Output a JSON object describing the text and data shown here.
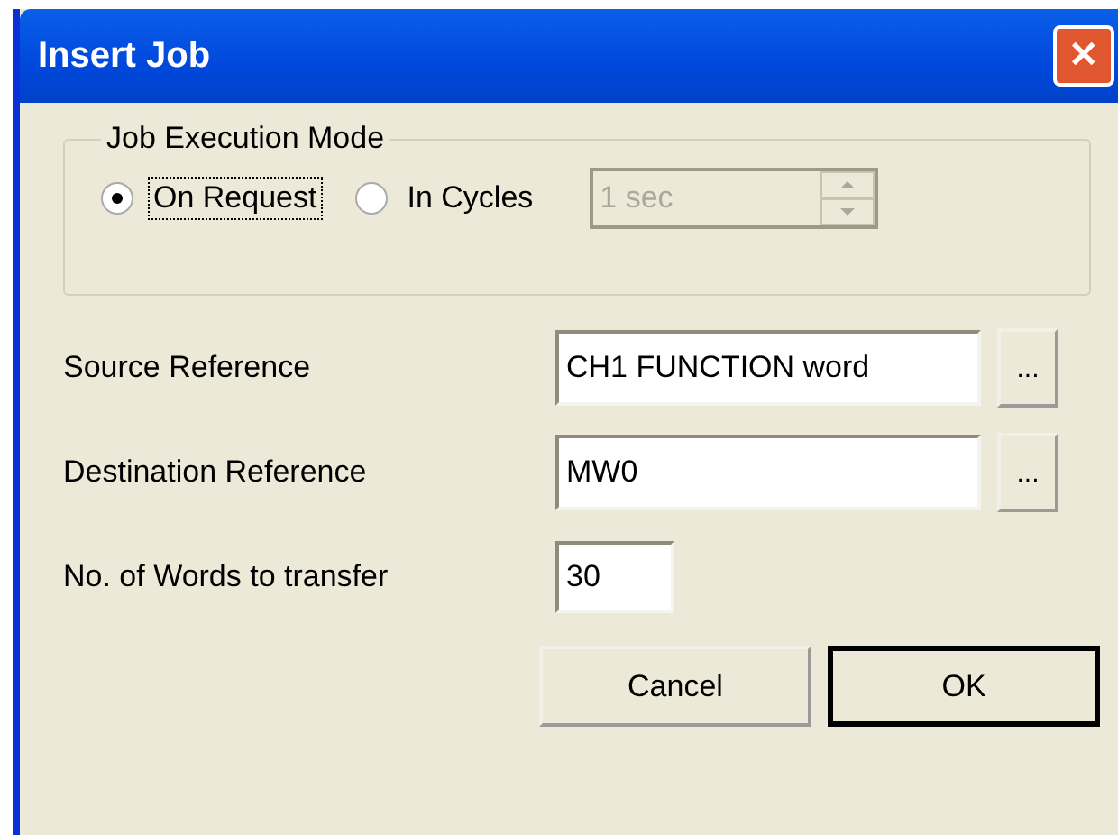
{
  "window": {
    "title": "Insert Job",
    "close": "✕"
  },
  "mode_group": {
    "title": "Job Execution Mode",
    "options": [
      {
        "label": "On Request",
        "selected": true,
        "focused": true
      },
      {
        "label": "In Cycles",
        "selected": false,
        "focused": false
      }
    ],
    "interval": {
      "value": "1 sec",
      "disabled": true
    }
  },
  "fields": [
    {
      "label": "Source Reference",
      "value": "CH1 FUNCTION word",
      "kind": "browse",
      "browse": "..."
    },
    {
      "label": "Destination Reference",
      "value": "MW0",
      "kind": "browse",
      "browse": "..."
    },
    {
      "label": "No. of Words to transfer",
      "value": "30",
      "kind": "short"
    }
  ],
  "buttons": [
    {
      "label": "Cancel",
      "default": false
    },
    {
      "label": "OK",
      "default": true
    }
  ]
}
